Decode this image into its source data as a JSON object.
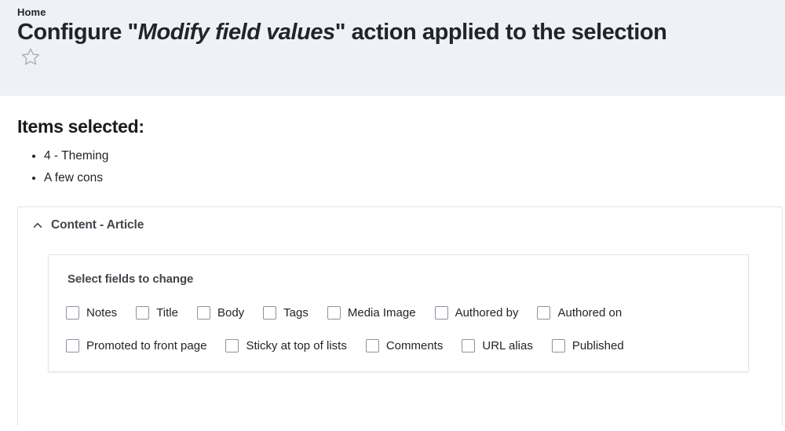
{
  "header": {
    "breadcrumb": "Home",
    "title_prefix": "Configure \"",
    "title_emphasis": "Modify field values",
    "title_suffix": "\" action applied to the selection",
    "star_icon": "star-outline-icon",
    "background_color": "#f0f1f7"
  },
  "main": {
    "items_selected_heading": "Items selected:",
    "items": [
      "4 - Theming",
      "A few cons"
    ]
  },
  "details": {
    "summary_label": "Content - Article",
    "toggle_icon": "chevron-up-icon",
    "expanded": true,
    "fieldset": {
      "legend": "Select fields to change",
      "rows": [
        [
          {
            "label": "Notes",
            "checked": false
          },
          {
            "label": "Title",
            "checked": false
          },
          {
            "label": "Body",
            "checked": false
          },
          {
            "label": "Tags",
            "checked": false
          },
          {
            "label": "Media Image",
            "checked": false
          },
          {
            "label": "Authored by",
            "checked": false
          },
          {
            "label": "Authored on",
            "checked": false
          }
        ],
        [
          {
            "label": "Promoted to front page",
            "checked": false
          },
          {
            "label": "Sticky at top of lists",
            "checked": false
          },
          {
            "label": "Comments",
            "checked": false
          },
          {
            "label": "URL alias",
            "checked": false
          },
          {
            "label": "Published",
            "checked": false
          }
        ]
      ]
    }
  },
  "colors": {
    "text": "#232429",
    "muted_text": "#45454b",
    "border": "#e6e4e1",
    "checkbox_border": "#8e929c",
    "header_bg": "#f0f1f7"
  }
}
